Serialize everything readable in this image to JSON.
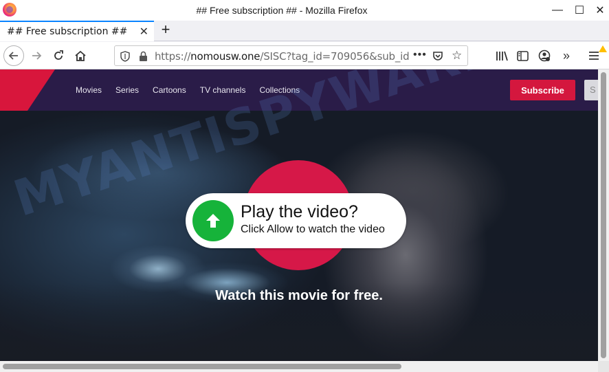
{
  "window": {
    "title": "## Free subscription ## - Mozilla Firefox",
    "minimize": "—",
    "maximize": "☐",
    "close": "✕"
  },
  "tab": {
    "label": "## Free subscription ##",
    "close": "✕",
    "new_tab": "+"
  },
  "urlbar": {
    "scheme": "https://",
    "domain": "nomousw.one",
    "path": "/SISC?tag_id=709056&sub_id",
    "more": "•••"
  },
  "toolbar": {
    "overflow": "»"
  },
  "site": {
    "nav": [
      "Movies",
      "Series",
      "Cartoons",
      "TV channels",
      "Collections"
    ],
    "subscribe": "Subscribe",
    "signin": "S"
  },
  "popup": {
    "title": "Play the video?",
    "subtitle": "Click Allow to watch the video"
  },
  "hero": {
    "caption": "Watch this movie for free."
  },
  "watermark": "MYANTISPYWARE.COM",
  "colors": {
    "accent_red": "#d4173e",
    "header_bg": "#2a1c48",
    "play_green": "#16b33a",
    "tab_highlight": "#0a84ff"
  }
}
